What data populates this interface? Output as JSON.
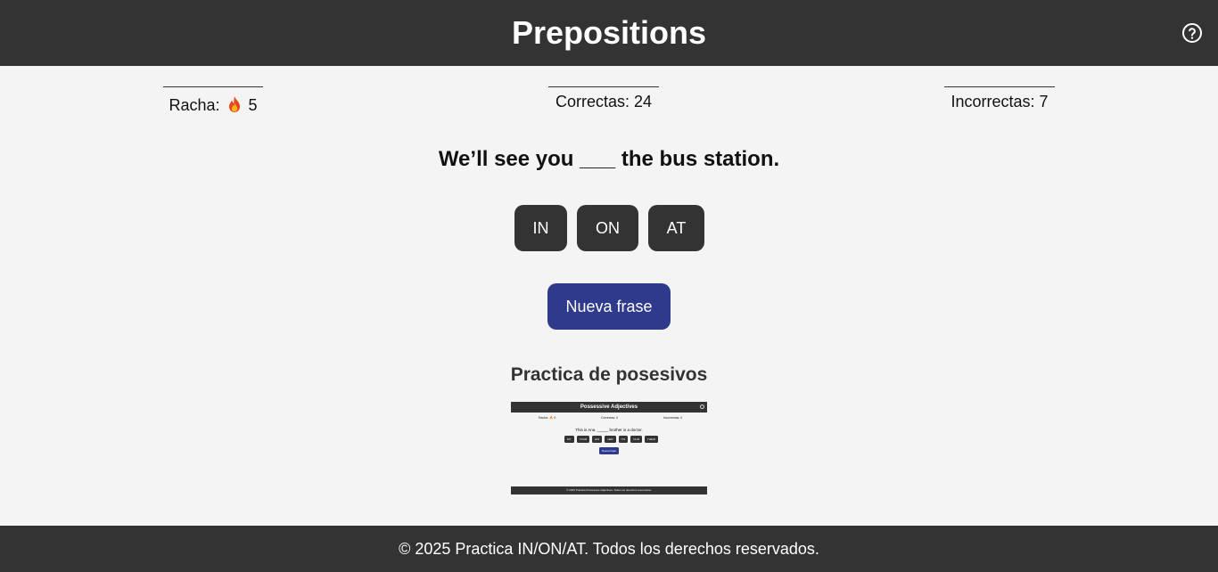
{
  "header": {
    "title": "Prepositions",
    "help_icon": "question-circle-icon"
  },
  "stats": {
    "streak_label": "Racha:",
    "streak_icon": "fire-icon",
    "streak_value": "5",
    "correct_text": "Correctas: 24",
    "incorrect_text": "Incorrectas: 7"
  },
  "quiz": {
    "sentence": "We’ll see you ___ the bus station.",
    "options": [
      "IN",
      "ON",
      "AT"
    ],
    "new_sentence_label": "Nueva frase"
  },
  "promo": {
    "title": "Practica de posesivos",
    "thumbnail": {
      "header_title": "Possessive Adjectives",
      "streak_text": "Racha: 🔥 0",
      "correct_text": "Correctas: 0",
      "incorrect_text": "Incorrectas: 0",
      "sentence": "This is Ana. _____ brother is a doctor.",
      "options": [
        "MY",
        "YOUR",
        "HIS",
        "HER",
        "ITS",
        "OUR",
        "THEIR"
      ],
      "new_sentence_label": "Nueva frase",
      "footer": "© 2025 Practica Possessive Adjectives. Todos los derechos reservados."
    }
  },
  "footer": {
    "text": "© 2025 Practica IN/ON/AT. Todos los derechos reservados."
  },
  "colors": {
    "header_bg": "#333333",
    "page_bg": "#f4f4f4",
    "option_bg": "#333333",
    "primary_button_bg": "#2e3a8c"
  }
}
